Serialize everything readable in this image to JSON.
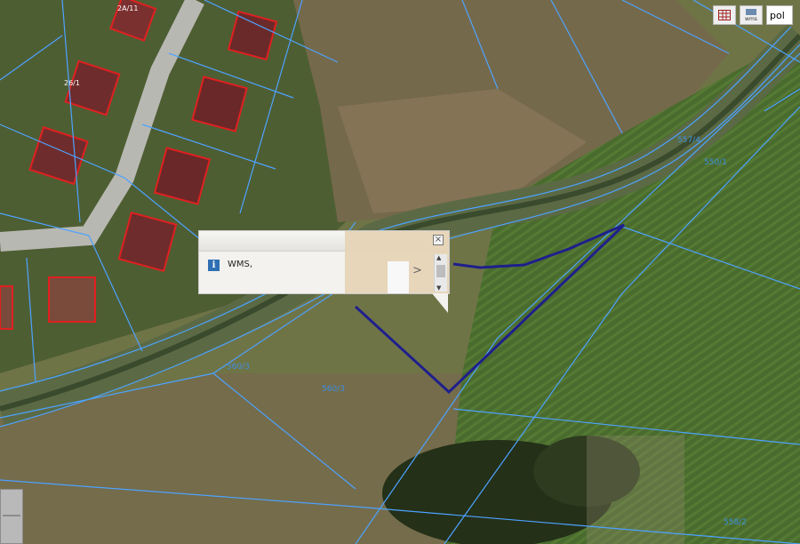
{
  "toolbar": {
    "language_value": "pol",
    "wms_icon_label": "wms"
  },
  "popup": {
    "text": "WMS,",
    "next_label": ">"
  },
  "parcels": {
    "p1": "560/3",
    "p2": "560/3",
    "p3": "558/2",
    "p4": "550/1",
    "p5": "557/4"
  },
  "houses": {
    "h1": "2A/11",
    "h2": "26/1"
  },
  "colors": {
    "parcel_line": "#4da3ff",
    "selected_parcel": "#1f1f8c",
    "building_outline": "#e02020"
  }
}
